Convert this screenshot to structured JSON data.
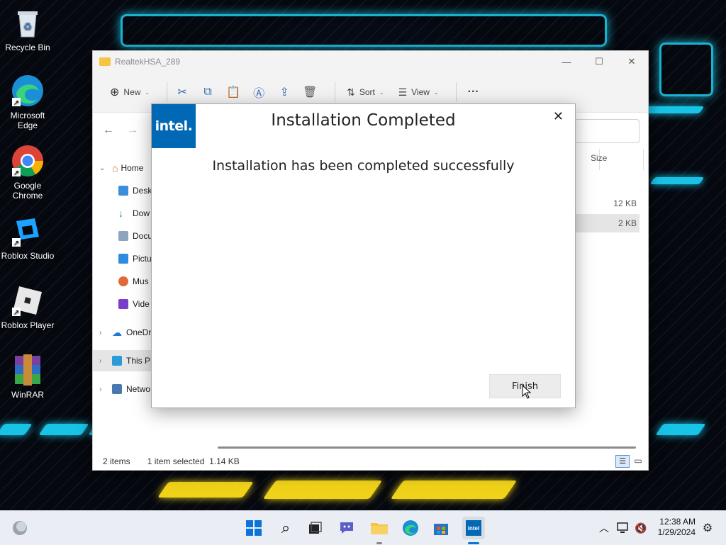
{
  "desktop": {
    "icons": [
      {
        "label": "Recycle Bin",
        "icon": "recycle-bin-icon"
      },
      {
        "label": "Microsoft Edge",
        "label_line1": "Microsoft",
        "label_line2": "Edge",
        "icon": "edge-icon"
      },
      {
        "label_line1": "Google",
        "label_line2": "Chrome",
        "icon": "chrome-icon"
      },
      {
        "label": "Roblox Studio",
        "icon": "roblox-studio-icon"
      },
      {
        "label": "Roblox Player",
        "icon": "roblox-player-icon"
      },
      {
        "label": "WinRAR",
        "icon": "winrar-icon"
      }
    ]
  },
  "explorer": {
    "title": "RealtekHSA_289",
    "toolbar": {
      "new_label": "New",
      "sort_label": "Sort",
      "view_label": "View",
      "more_label": "···"
    },
    "column_size_header": "Size",
    "sidebar": {
      "items": [
        {
          "label": "Home",
          "icon": "home-icon"
        },
        {
          "label": "Desk",
          "icon": "desktop-icon"
        },
        {
          "label": "Dow",
          "icon": "downloads-icon"
        },
        {
          "label": "Docu",
          "icon": "documents-icon"
        },
        {
          "label": "Pictu",
          "icon": "pictures-icon"
        },
        {
          "label": "Mus",
          "icon": "music-icon"
        },
        {
          "label": "Vide",
          "icon": "videos-icon"
        },
        {
          "label": "OneDr",
          "icon": "onedrive-icon"
        },
        {
          "label": "This P",
          "icon": "this-pc-icon"
        },
        {
          "label": "Netwo",
          "icon": "network-icon"
        }
      ]
    },
    "files": [
      {
        "size": "12 KB"
      },
      {
        "size": "2 KB"
      }
    ],
    "status": {
      "items": "2 items",
      "selected": "1 item selected  1.14 KB"
    }
  },
  "dialog": {
    "logo_text": "intel.",
    "title": "Installation Completed",
    "message": "Installation has been completed successfully",
    "close_glyph": "✕",
    "finish_label": "Finish"
  },
  "taskbar": {
    "time": "12:38 AM",
    "date": "1/29/2024",
    "pinned": [
      "start-icon",
      "search-icon",
      "task-view-icon",
      "chat-icon",
      "file-explorer-icon",
      "edge-icon",
      "store-icon",
      "intel-icon"
    ]
  },
  "colors": {
    "intel_blue": "#0068b5",
    "wallpaper_cyan": "#19c3e6",
    "wallpaper_yellow": "#f1d21a"
  }
}
